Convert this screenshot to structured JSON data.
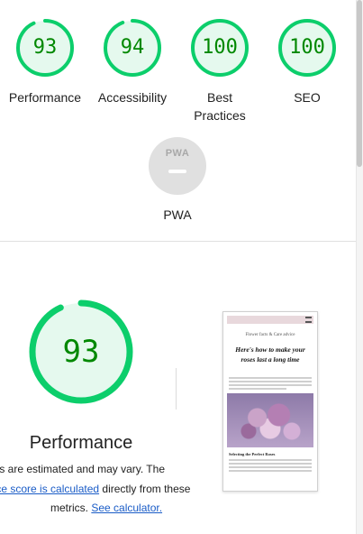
{
  "categories": [
    {
      "score": "93",
      "label": "Performance",
      "value": 93
    },
    {
      "score": "94",
      "label": "Accessibility",
      "value": 94
    },
    {
      "score": "100",
      "label": "Best Practices",
      "value": 100
    },
    {
      "score": "100",
      "label": "SEO",
      "value": 100
    }
  ],
  "pwa": {
    "badge_text": "PWA",
    "label": "PWA"
  },
  "performance": {
    "score": "93",
    "value": 93,
    "label": "Performance",
    "desc_part1": "ues are estimated and may vary. The",
    "desc_link1": "ance score is calculated",
    "desc_part2": " directly from these",
    "desc_part3": "metrics. ",
    "desc_link2": "See calculator."
  },
  "screenshot": {
    "site_title": "Flower facts & Care advice",
    "headline": "Here's how to make your roses last a long time",
    "subheading": "Selecting the Perfect Roses"
  },
  "colors": {
    "pass": "#0cce6b",
    "pass_bg": "#e5f9ee",
    "pass_text": "#008800",
    "link": "#1a5cc7"
  }
}
